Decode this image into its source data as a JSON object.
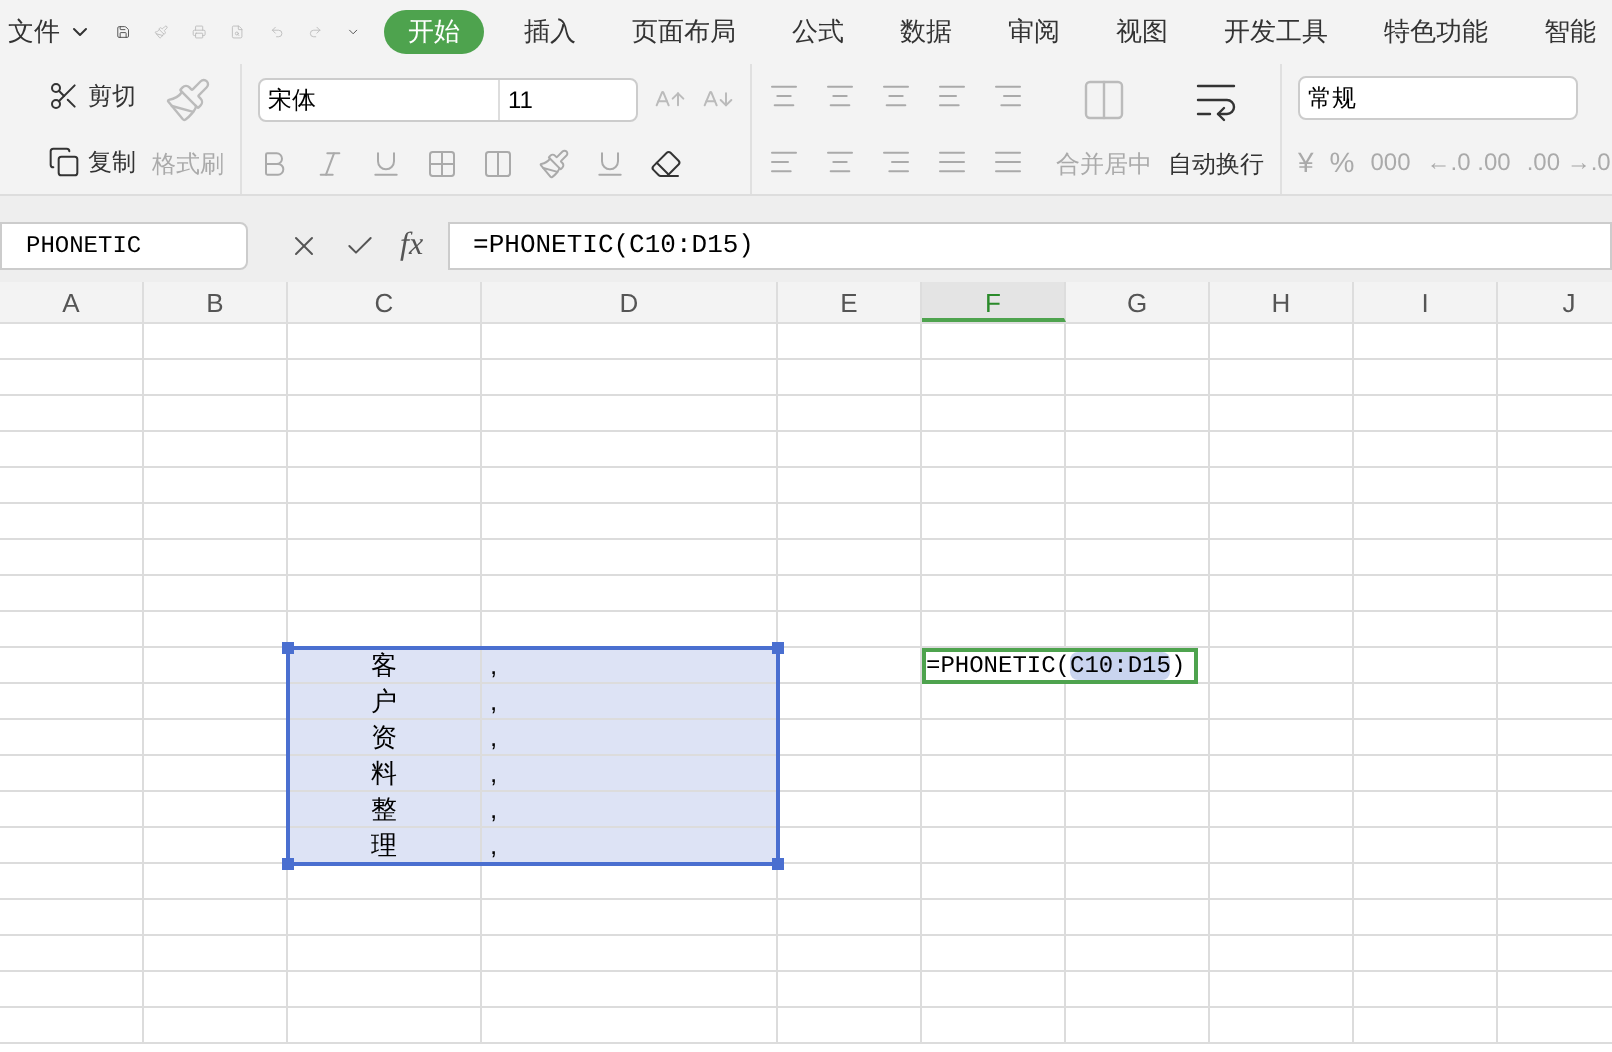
{
  "menu": {
    "file": "文件"
  },
  "tabs": [
    {
      "label": "开始",
      "selected": true
    },
    {
      "label": "插入",
      "selected": false
    },
    {
      "label": "页面布局",
      "selected": false
    },
    {
      "label": "公式",
      "selected": false
    },
    {
      "label": "数据",
      "selected": false
    },
    {
      "label": "审阅",
      "selected": false
    },
    {
      "label": "视图",
      "selected": false
    },
    {
      "label": "开发工具",
      "selected": false
    },
    {
      "label": "特色功能",
      "selected": false
    },
    {
      "label": "智能",
      "selected": false
    }
  ],
  "ribbon": {
    "cut": "剪切",
    "copy": "复制",
    "format_painter": "格式刷",
    "font": "宋体",
    "font_size": "11",
    "merge_center": "合并居中",
    "wrap_text": "自动换行",
    "number_format": "常规",
    "currency": "¥",
    "percent": "%",
    "thousands": "000",
    "increase_decimal": "←.0 .00",
    "decrease_decimal": ".00 →.0"
  },
  "formula_bar": {
    "name_box": "PHONETIC",
    "fx": "fx",
    "formula": "=PHONETIC(C10:D15)"
  },
  "grid": {
    "columns": [
      "A",
      "B",
      "C",
      "D",
      "E",
      "F",
      "G",
      "H",
      "I",
      "J"
    ],
    "selected_block": [
      {
        "column_c": "客",
        "column_d": ","
      },
      {
        "column_c": "户",
        "column_d": ","
      },
      {
        "column_c": "资",
        "column_d": ","
      },
      {
        "column_c": "料",
        "column_d": ","
      },
      {
        "column_c": "整",
        "column_d": ","
      },
      {
        "column_c": "理",
        "column_d": ","
      }
    ],
    "active_cell": {
      "before": "=PHONETIC(",
      "reference": "C10:D15",
      "after": ")"
    }
  }
}
